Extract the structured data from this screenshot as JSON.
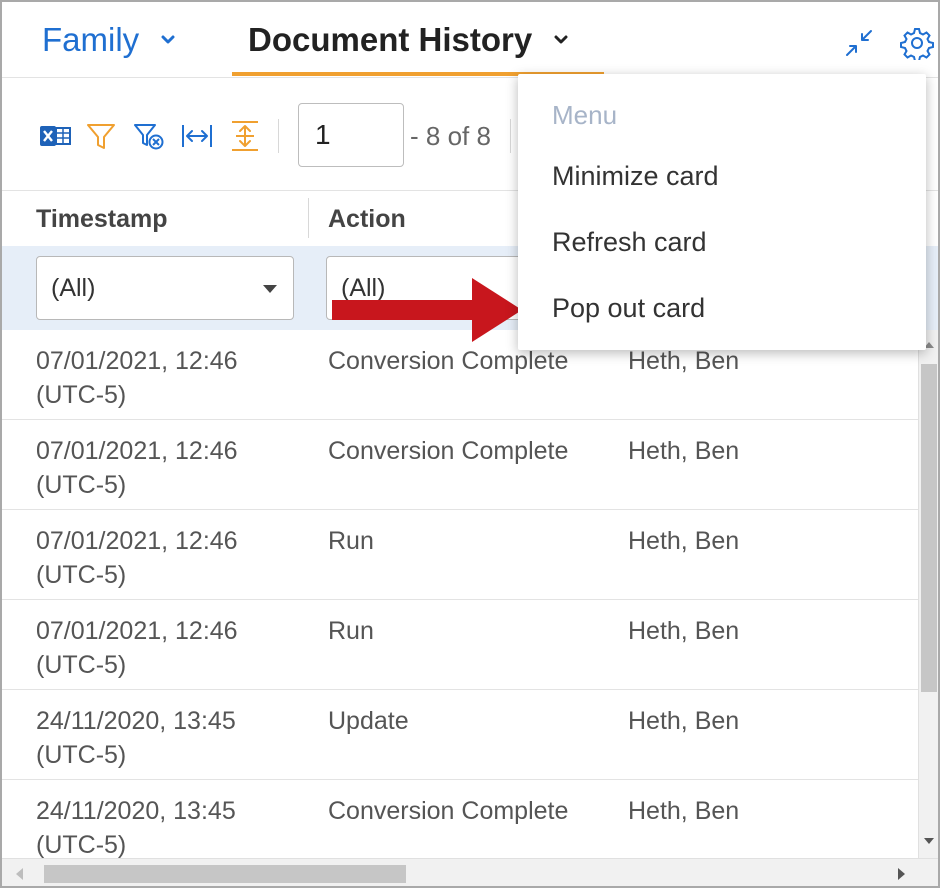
{
  "header": {
    "tabs": [
      {
        "label": "Family"
      },
      {
        "label": "Document History"
      }
    ]
  },
  "toolbar": {
    "page_input_value": "1",
    "page_count": "- 8 of 8"
  },
  "table": {
    "columns": [
      "Timestamp",
      "Action"
    ],
    "filters": [
      "(All)",
      "(All)"
    ],
    "rows": [
      {
        "timestamp_line1": "07/01/2021, 12:46",
        "timestamp_line2": "(UTC-5)",
        "action": "Conversion Complete",
        "user": "Heth, Ben"
      },
      {
        "timestamp_line1": "07/01/2021, 12:46",
        "timestamp_line2": "(UTC-5)",
        "action": "Conversion Complete",
        "user": "Heth, Ben"
      },
      {
        "timestamp_line1": "07/01/2021, 12:46",
        "timestamp_line2": "(UTC-5)",
        "action": "Run",
        "user": "Heth, Ben"
      },
      {
        "timestamp_line1": "07/01/2021, 12:46",
        "timestamp_line2": "(UTC-5)",
        "action": "Run",
        "user": "Heth, Ben"
      },
      {
        "timestamp_line1": "24/11/2020, 13:45",
        "timestamp_line2": "(UTC-5)",
        "action": "Update",
        "user": "Heth, Ben"
      },
      {
        "timestamp_line1": "24/11/2020, 13:45",
        "timestamp_line2": "(UTC-5)",
        "action": "Conversion Complete",
        "user": "Heth, Ben"
      }
    ]
  },
  "menu": {
    "title": "Menu",
    "items": [
      {
        "label": "Minimize card"
      },
      {
        "label": "Refresh card"
      },
      {
        "label": "Pop out card"
      }
    ]
  },
  "icons": {
    "header": [
      "chevron-down-icon",
      "collapse-icon",
      "gear-icon"
    ],
    "toolbar": [
      "excel-export-icon",
      "filter-icon",
      "clear-filter-icon",
      "fit-columns-icon",
      "fit-rows-icon"
    ],
    "annotation": "red-arrow-icon"
  },
  "colors": {
    "accent_blue": "#1f6fd1",
    "tab_underline": "#f0a030",
    "filter_row_bg": "#e6eef8",
    "annotation_arrow": "#c8161d",
    "menu_title": "#a7b4c8"
  }
}
